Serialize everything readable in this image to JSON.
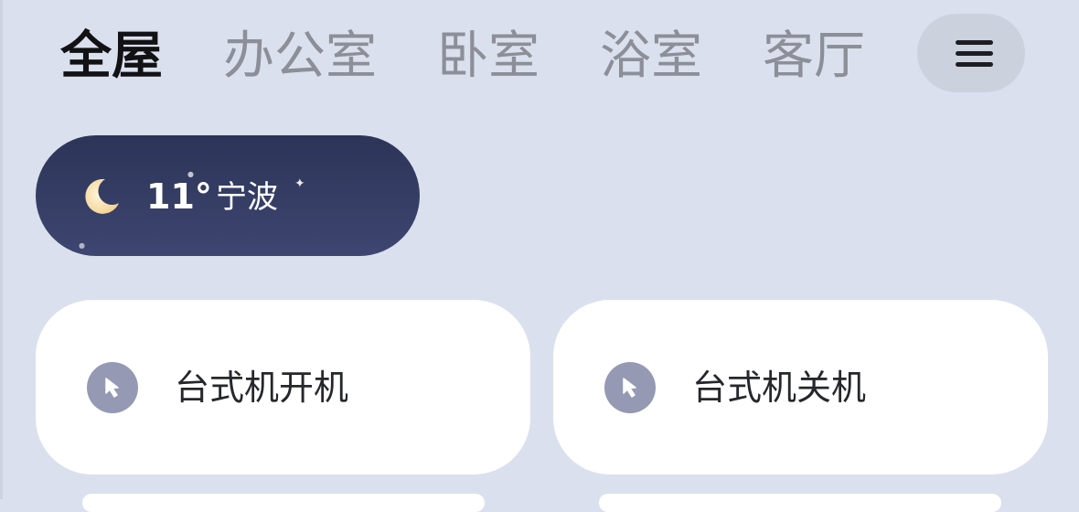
{
  "rooms": {
    "tabs": [
      {
        "label": "全屋",
        "active": true
      },
      {
        "label": "办公室",
        "active": false
      },
      {
        "label": "卧室",
        "active": false
      },
      {
        "label": "浴室",
        "active": false
      },
      {
        "label": "客厅",
        "active": false
      }
    ],
    "menu_icon": "hamburger-menu-icon"
  },
  "weather": {
    "icon": "moon-icon",
    "temperature": "11°",
    "city": "宁波"
  },
  "scenes": [
    {
      "icon": "cursor-arrow-icon",
      "label": "台式机开机"
    },
    {
      "icon": "cursor-arrow-icon",
      "label": "台式机关机"
    }
  ],
  "colors": {
    "background": "#dbe0ee",
    "weather_pill": "#343c64",
    "card": "#ffffff",
    "scene_icon": "#9599b3",
    "active_tab": "#121214",
    "inactive_tab": "#8c8f97"
  }
}
